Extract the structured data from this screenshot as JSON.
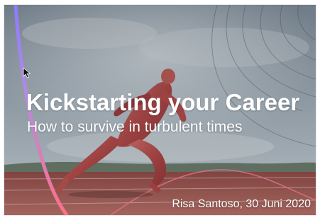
{
  "slide": {
    "title": "Kickstarting your Career",
    "subtitle": "How to survive in turbulent times",
    "byline": "Risa Santoso, 30 Juni 2020"
  },
  "icons": {
    "cursor": "mouse-pointer-icon"
  },
  "colors": {
    "text": "#ffffff",
    "sky": "#9aa9b5",
    "track": "#9a5852",
    "accent_ribbon_top": "#8c7cff",
    "accent_ribbon_bottom": "#ff6f88",
    "figure_muscle": "#b54a4c"
  }
}
